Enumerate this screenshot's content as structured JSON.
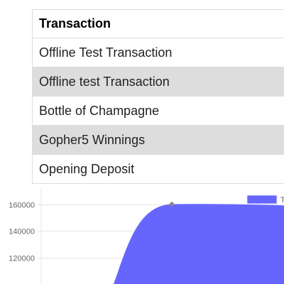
{
  "table": {
    "header": "Transaction",
    "rows": [
      "Offline Test Transaction",
      "Offline test Transaction",
      "Bottle of Champagne",
      "Gopher5 Winnings",
      "Opening Deposit"
    ]
  },
  "chart_data": {
    "type": "area",
    "y_ticks": [
      "160000",
      "140000",
      "120000"
    ],
    "ylim": [
      100000,
      172000
    ],
    "series": [
      {
        "name": "T",
        "color": "#6666ff",
        "points": [
          {
            "x": 0,
            "y": 100000
          },
          {
            "x": 1,
            "y": 160000
          },
          {
            "x": 2,
            "y": 159000
          }
        ]
      }
    ],
    "legend_position": "top-right",
    "grid": true
  }
}
